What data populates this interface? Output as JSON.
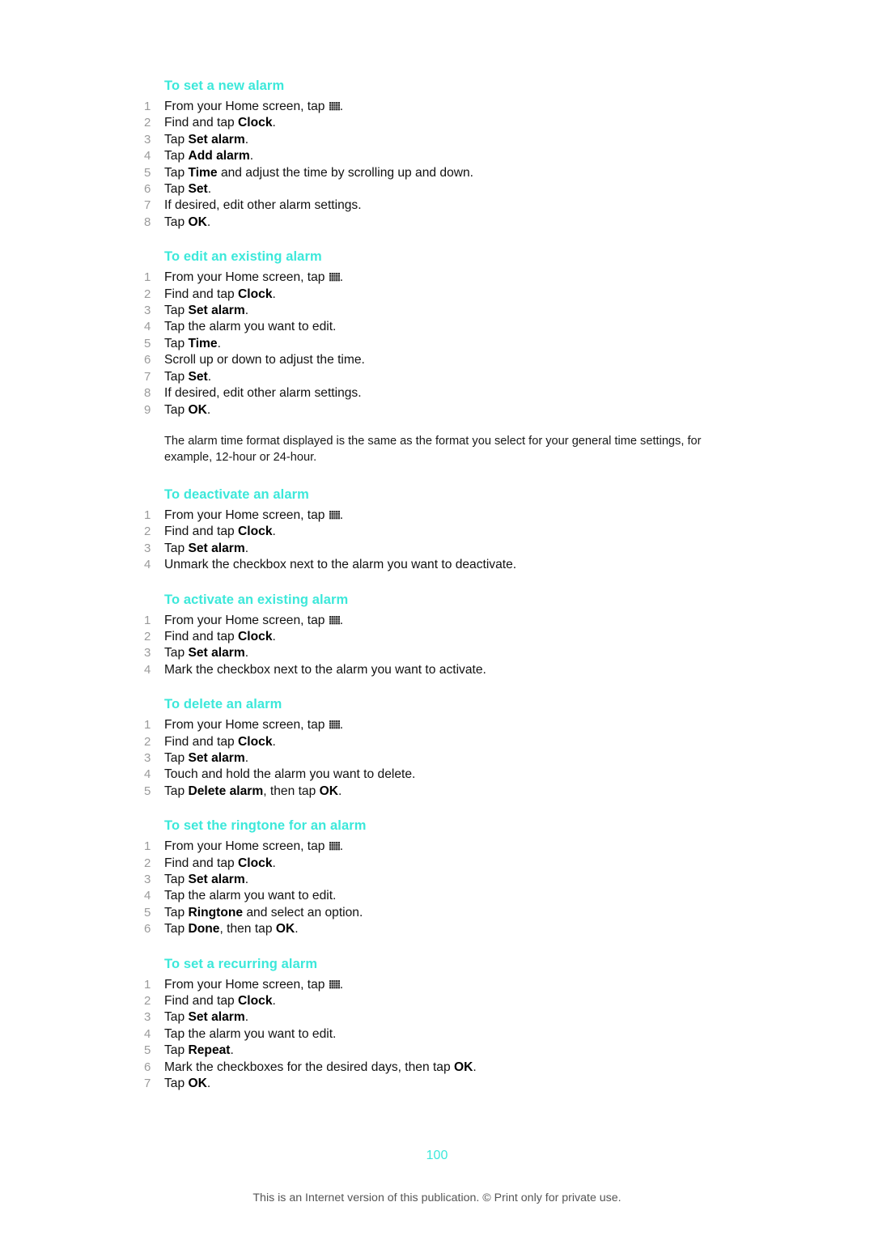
{
  "page": {
    "number": "100",
    "footer_note": "This is an Internet version of this publication. © Print only for private use.",
    "accent_color": "#3CE8DA",
    "number_color": "#9a9a9a",
    "text_color": "#111111",
    "background": "#ffffff"
  },
  "icons": {
    "app_drawer": "app-drawer-grid-icon"
  },
  "sections": [
    {
      "heading": "To set a new alarm",
      "steps": [
        {
          "num": "1",
          "pre": "From your Home screen, tap ",
          "icon": true,
          "post": "."
        },
        {
          "num": "2",
          "pre": "Find and tap ",
          "bold": "Clock",
          "post": "."
        },
        {
          "num": "3",
          "pre": "Tap ",
          "bold": "Set alarm",
          "post": "."
        },
        {
          "num": "4",
          "pre": "Tap ",
          "bold": "Add alarm",
          "post": "."
        },
        {
          "num": "5",
          "pre": "Tap ",
          "bold": "Time",
          "post": " and adjust the time by scrolling up and down."
        },
        {
          "num": "6",
          "pre": "Tap ",
          "bold": "Set",
          "post": "."
        },
        {
          "num": "7",
          "pre": "If desired, edit other alarm settings.",
          "post": ""
        },
        {
          "num": "8",
          "pre": "Tap ",
          "bold": "OK",
          "post": "."
        }
      ]
    },
    {
      "heading": "To edit an existing alarm",
      "steps": [
        {
          "num": "1",
          "pre": "From your Home screen, tap ",
          "icon": true,
          "post": "."
        },
        {
          "num": "2",
          "pre": "Find and tap ",
          "bold": "Clock",
          "post": "."
        },
        {
          "num": "3",
          "pre": "Tap ",
          "bold": "Set alarm",
          "post": "."
        },
        {
          "num": "4",
          "pre": "Tap the alarm you want to edit.",
          "post": ""
        },
        {
          "num": "5",
          "pre": "Tap ",
          "bold": "Time",
          "post": "."
        },
        {
          "num": "6",
          "pre": "Scroll up or down to adjust the time.",
          "post": ""
        },
        {
          "num": "7",
          "pre": "Tap ",
          "bold": "Set",
          "post": "."
        },
        {
          "num": "8",
          "pre": "If desired, edit other alarm settings.",
          "post": ""
        },
        {
          "num": "9",
          "pre": "Tap ",
          "bold": "OK",
          "post": "."
        }
      ],
      "note": "The alarm time format displayed is the same as the format you select for your general time settings, for example, 12-hour or 24-hour."
    },
    {
      "heading": "To deactivate an alarm",
      "steps": [
        {
          "num": "1",
          "pre": "From your Home screen, tap ",
          "icon": true,
          "post": "."
        },
        {
          "num": "2",
          "pre": "Find and tap ",
          "bold": "Clock",
          "post": "."
        },
        {
          "num": "3",
          "pre": "Tap ",
          "bold": "Set alarm",
          "post": "."
        },
        {
          "num": "4",
          "pre": "Unmark the checkbox next to the alarm you want to deactivate.",
          "post": ""
        }
      ]
    },
    {
      "heading": "To activate an existing alarm",
      "steps": [
        {
          "num": "1",
          "pre": "From your Home screen, tap ",
          "icon": true,
          "post": "."
        },
        {
          "num": "2",
          "pre": "Find and tap ",
          "bold": "Clock",
          "post": "."
        },
        {
          "num": "3",
          "pre": "Tap ",
          "bold": "Set alarm",
          "post": "."
        },
        {
          "num": "4",
          "pre": "Mark the checkbox next to the alarm you want to activate.",
          "post": ""
        }
      ]
    },
    {
      "heading": "To delete an alarm",
      "steps": [
        {
          "num": "1",
          "pre": "From your Home screen, tap ",
          "icon": true,
          "post": "."
        },
        {
          "num": "2",
          "pre": "Find and tap ",
          "bold": "Clock",
          "post": "."
        },
        {
          "num": "3",
          "pre": "Tap ",
          "bold": "Set alarm",
          "post": "."
        },
        {
          "num": "4",
          "pre": "Touch and hold the alarm you want to delete.",
          "post": ""
        },
        {
          "num": "5",
          "pre": "Tap ",
          "bold": "Delete alarm",
          "mid": ", then tap ",
          "bold2": "OK",
          "post": "."
        }
      ]
    },
    {
      "heading": "To set the ringtone for an alarm",
      "steps": [
        {
          "num": "1",
          "pre": "From your Home screen, tap ",
          "icon": true,
          "post": "."
        },
        {
          "num": "2",
          "pre": "Find and tap ",
          "bold": "Clock",
          "post": "."
        },
        {
          "num": "3",
          "pre": "Tap ",
          "bold": "Set alarm",
          "post": "."
        },
        {
          "num": "4",
          "pre": "Tap the alarm you want to edit.",
          "post": ""
        },
        {
          "num": "5",
          "pre": "Tap ",
          "bold": "Ringtone",
          "post": " and select an option."
        },
        {
          "num": "6",
          "pre": "Tap ",
          "bold": "Done",
          "mid": ", then tap ",
          "bold2": "OK",
          "post": "."
        }
      ]
    },
    {
      "heading": "To set a recurring alarm",
      "steps": [
        {
          "num": "1",
          "pre": "From your Home screen, tap ",
          "icon": true,
          "post": "."
        },
        {
          "num": "2",
          "pre": "Find and tap ",
          "bold": "Clock",
          "post": "."
        },
        {
          "num": "3",
          "pre": "Tap ",
          "bold": "Set alarm",
          "post": "."
        },
        {
          "num": "4",
          "pre": "Tap the alarm you want to edit.",
          "post": ""
        },
        {
          "num": "5",
          "pre": "Tap ",
          "bold": "Repeat",
          "post": "."
        },
        {
          "num": "6",
          "pre": "Mark the checkboxes for the desired days, then tap ",
          "bold": "OK",
          "post": "."
        },
        {
          "num": "7",
          "pre": "Tap ",
          "bold": "OK",
          "post": "."
        }
      ]
    }
  ]
}
